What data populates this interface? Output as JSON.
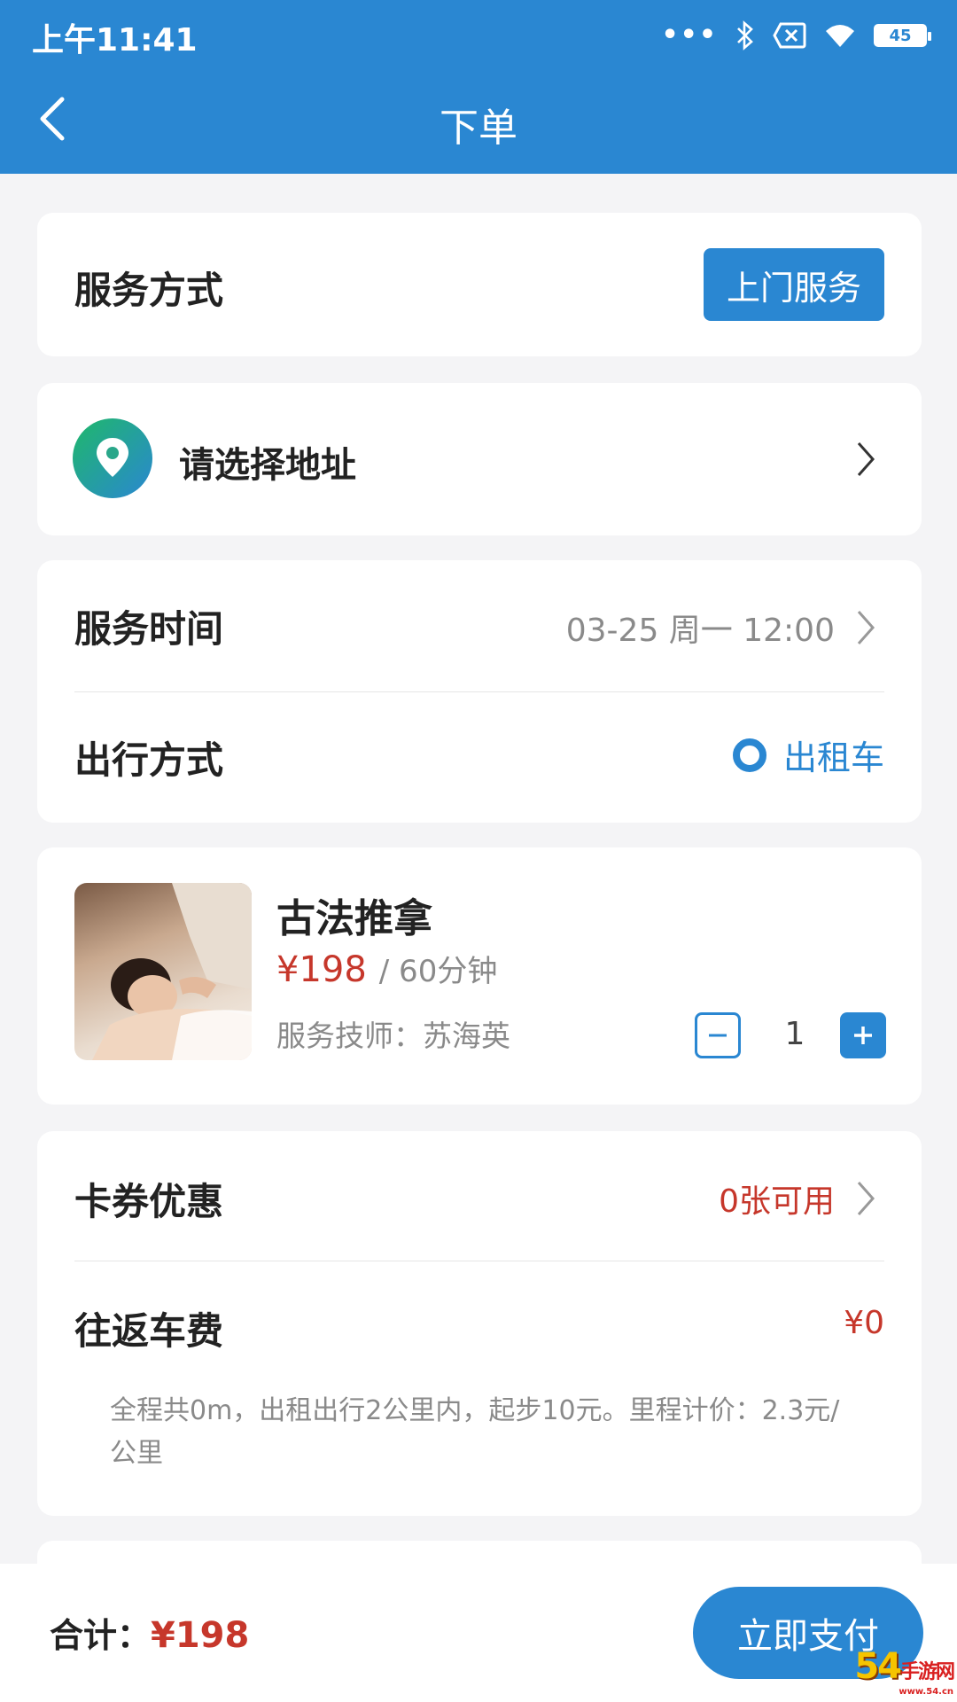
{
  "status_bar": {
    "time": "上午11:41",
    "dots": "•••",
    "battery": "45"
  },
  "header": {
    "title": "下单"
  },
  "service_mode": {
    "label": "服务方式",
    "button": "上门服务"
  },
  "address": {
    "placeholder": "请选择地址"
  },
  "schedule": {
    "time_label": "服务时间",
    "time_value": "03-25 周一 12:00",
    "travel_label": "出行方式",
    "travel_value": "出租车"
  },
  "product": {
    "name": "古法推拿",
    "price": "¥198",
    "duration": "/ 60分钟",
    "technician": "服务技师：苏海英",
    "quantity": "1"
  },
  "fees": {
    "coupon_label": "卡券优惠",
    "coupon_value": "0张可用",
    "fare_label": "往返车费",
    "fare_value": "¥0",
    "fare_note": "全程共0m，出租出行2公里内，起步10元。里程计价：2.3元/公里"
  },
  "footer": {
    "total_label": "合计：",
    "total_value": "¥198",
    "pay_button": "立即支付"
  },
  "watermark": {
    "main": "54",
    "sub": "手游网",
    "domain": "www.54.cn"
  },
  "colors": {
    "primary": "#2a87d2",
    "price_red": "#c6372b",
    "background": "#f4f4f6"
  }
}
